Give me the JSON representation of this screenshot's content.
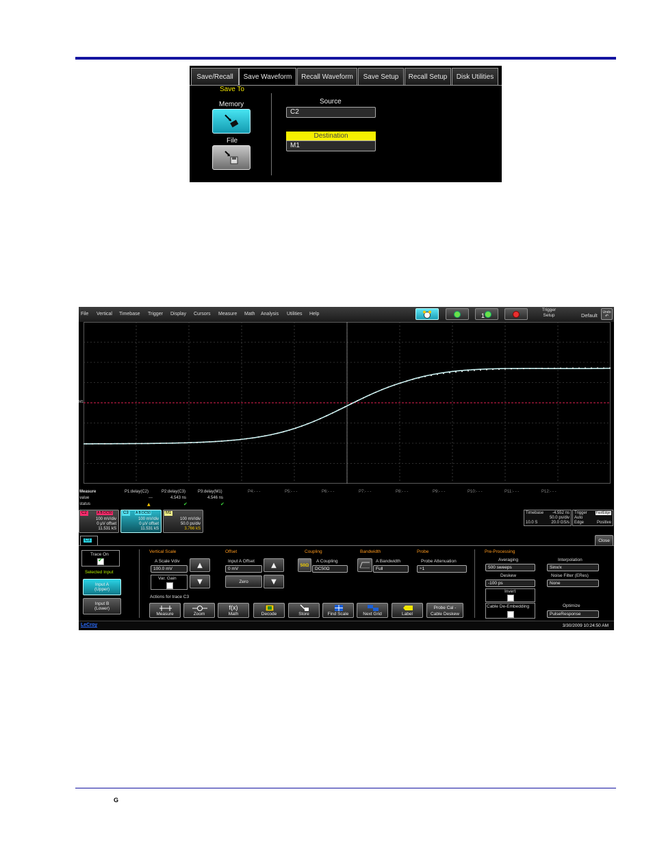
{
  "screenshot1": {
    "tabs": [
      "Save/Recall",
      "Save Waveform",
      "Recall Waveform",
      "Save Setup",
      "Recall Setup",
      "Disk Utilities"
    ],
    "active_tab": "Save Waveform",
    "save_to_label": "Save To",
    "memory_label": "Memory",
    "file_label": "File",
    "source_label": "Source",
    "source_value": "C2",
    "destination_label": "Destination",
    "destination_value": "M1",
    "selected_save_to": "Memory"
  },
  "screenshot2": {
    "menu": [
      "File",
      "Vertical",
      "Timebase",
      "Trigger",
      "Display",
      "Cursors",
      "Measure",
      "Math",
      "Analysis",
      "Utilities",
      "Help"
    ],
    "toolbar": {
      "trigger_setup_line1": "Trigger",
      "trigger_setup_line2": "Setup",
      "default_label": "Default",
      "undo_label": "Undo",
      "icons": [
        "auto-setup-icon",
        "single-trigger-icon",
        "normal-trigger-icon",
        "stop-icon"
      ]
    },
    "grid": {
      "marker_label": "M1",
      "colors": {
        "trace": "#c8f0f0",
        "reference": "#e02050",
        "grid": "#5a5a5a"
      }
    },
    "measure": {
      "row_labels": [
        "Measure",
        "value",
        "status"
      ],
      "params": [
        {
          "name": "P1:delay(C2)",
          "value": "---",
          "status": "warning"
        },
        {
          "name": "P2:delay(C3)",
          "value": "4.543 ns",
          "status": "ok"
        },
        {
          "name": "P3:delay(M1)",
          "value": "4.546 ns",
          "status": "ok"
        },
        {
          "name": "P4:- - -"
        },
        {
          "name": "P5:- - -"
        },
        {
          "name": "P6:- - -"
        },
        {
          "name": "P7:- - -"
        },
        {
          "name": "P8:- - -"
        },
        {
          "name": "P9:- - -"
        },
        {
          "name": "P10:- - -"
        },
        {
          "name": "P11:- - -"
        },
        {
          "name": "P12:- - -"
        }
      ]
    },
    "trace_descriptors": [
      {
        "tag": "C2",
        "flags": "A B DC50",
        "line1": "100 mV/div",
        "line2": "0 µV offset",
        "line3": "11.531 kS"
      },
      {
        "tag": "C3",
        "flags": "A B DC50",
        "line1": "100 mV/div",
        "line2": "0 µV offset",
        "line3": "11.531 kS"
      },
      {
        "tag": "M1",
        "flags": "",
        "line1": "100 mV/div",
        "line2": "50.0 ps/div",
        "line3": "3.766 kS"
      }
    ],
    "timebase": {
      "label": "Timebase",
      "delay": "-4.552 ns",
      "per_div": "50.0 ps/div",
      "sweep": "10.0 S",
      "rate": "20.0 GS/s"
    },
    "trigger": {
      "label": "Trigger",
      "type": "FastEdge",
      "mode": "Auto",
      "slope_type": "Edge",
      "slope": "Positive"
    },
    "dock": {
      "tab": "C3",
      "close": "Close",
      "trace_on": "Trace On",
      "selected_input": "Selected Input",
      "input_a_line1": "Input A",
      "input_a_line2": "(Upper)",
      "input_b_line1": "Input B",
      "input_b_line2": "(Lower)",
      "vertical_scale": "Vertical Scale",
      "a_scale_label": "A Scale Vdiv",
      "a_scale_value": "100.0 mV",
      "var_gain": "Var. Gain",
      "offset": "Offset",
      "input_a_offset": "Input A Offset",
      "offset_value": "0 mV",
      "zero": "Zero",
      "coupling": "Coupling",
      "a_coupling": "A Coupling",
      "coupling_value": "DC50Ω",
      "coupling_badge": "50Ω",
      "bandwidth": "Bandwidth",
      "a_bandwidth": "A Bandwidth",
      "bandwidth_value": "Full",
      "probe": "Probe",
      "probe_attenuation": "Probe Attenuation",
      "probe_value": "÷1",
      "pre_processing": "Pre-Processing",
      "averaging": "Averaging",
      "averaging_value": "500 sweeps",
      "deskew": "Deskew",
      "deskew_value": "-100 ps",
      "invert": "Invert",
      "cable_deembedding": "Cable De-Embedding",
      "interpolation": "Interpolation",
      "interpolation_value": "Sinx/x",
      "noise_filter": "Noise Filter (ERes)",
      "noise_filter_value": "None",
      "optimize": "Optimize",
      "optimize_value": "PulseResponse",
      "actions_label": "Actions for trace C3",
      "actions": [
        "Measure",
        "Zoom",
        "Math",
        "Decode",
        "Store",
        "Find Scale",
        "Next Grid",
        "Label"
      ],
      "probe_cal_line1": "Probe Cal -",
      "probe_cal_line2": "Cable Deskew"
    },
    "status": {
      "brand": "LeCroy",
      "datetime": "3/30/2009 10:24:50 AM"
    }
  },
  "footer": {
    "letter": "G"
  }
}
